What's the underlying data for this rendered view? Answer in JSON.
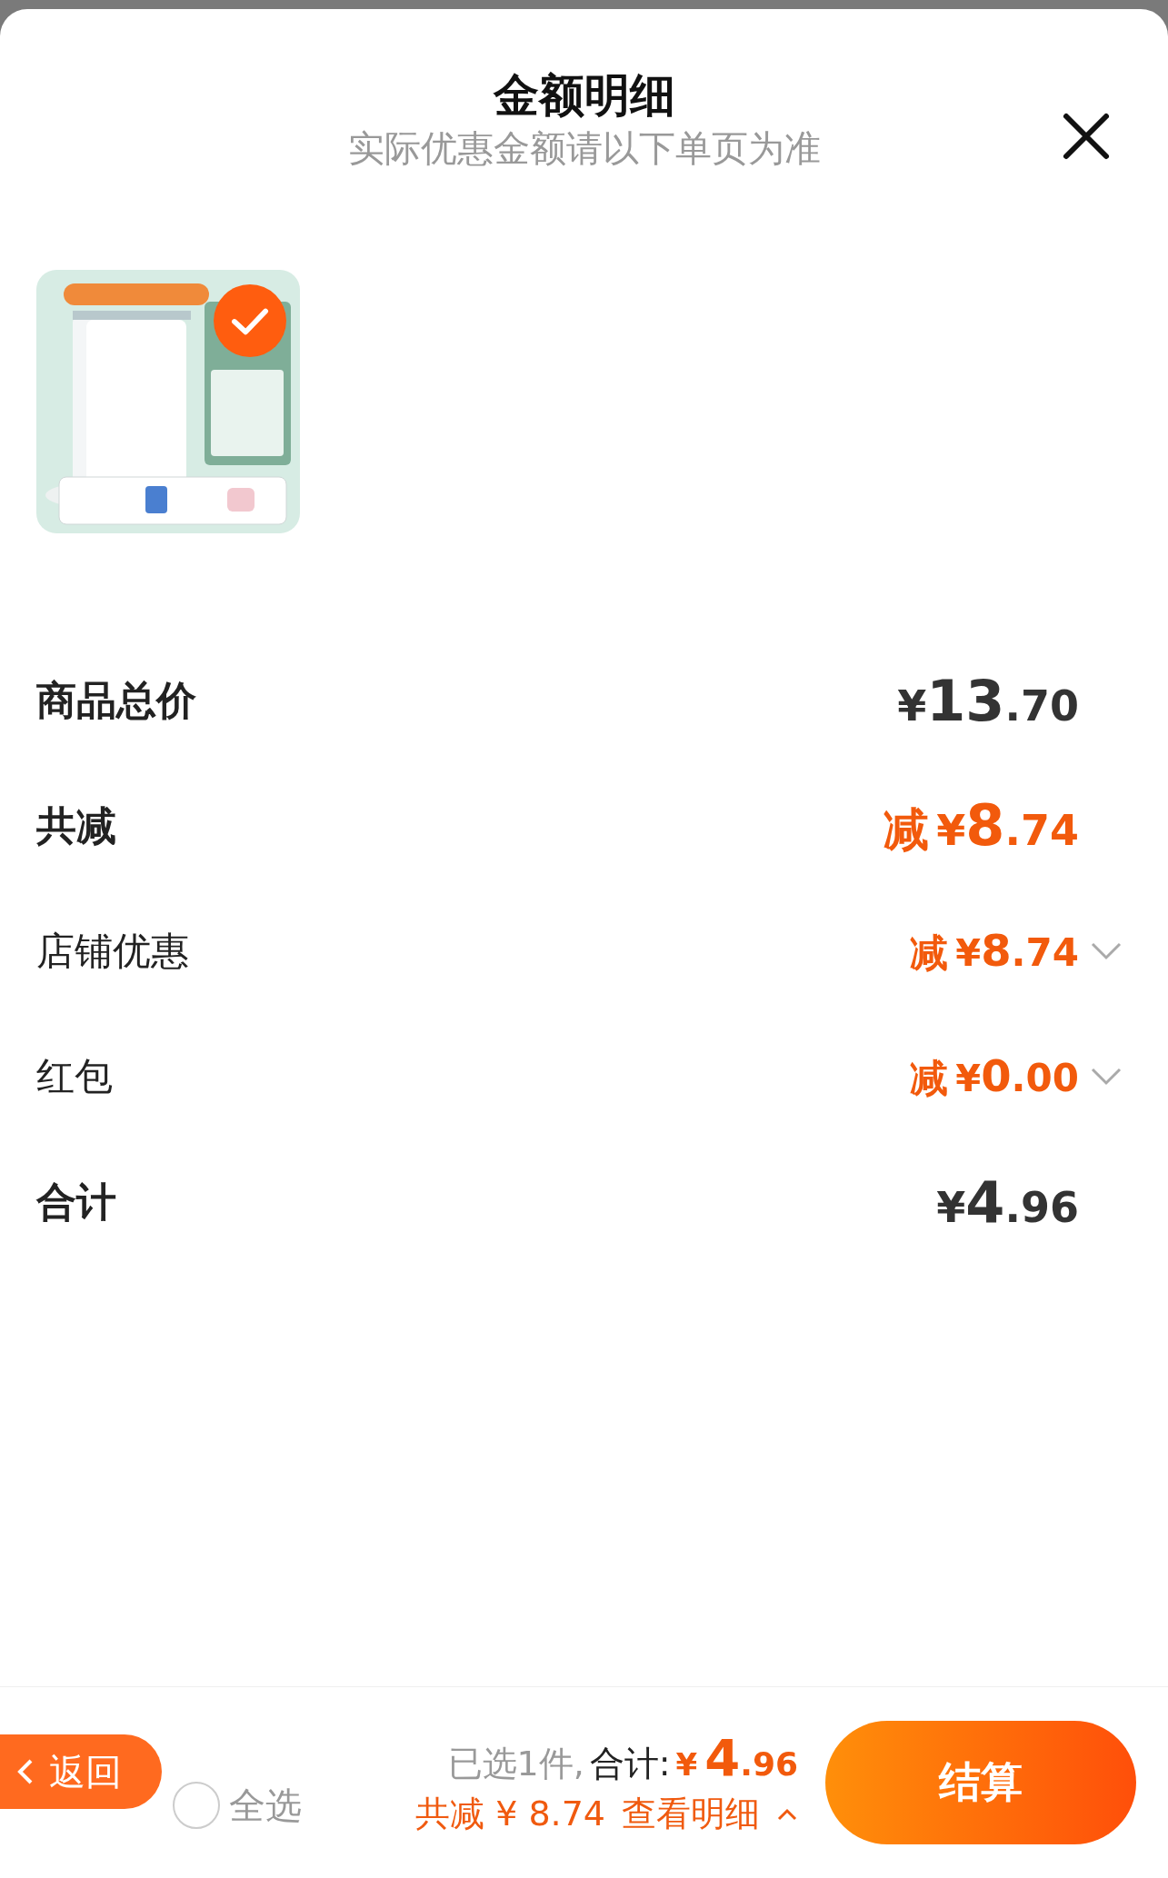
{
  "sheet": {
    "title": "金额明细",
    "subtitle": "实际优惠金额请以下单页为准"
  },
  "product": {
    "kind": "picture",
    "selected": true
  },
  "rows": [
    {
      "kind": "total",
      "label": "商品总价",
      "currency": "¥",
      "integer": "13",
      "fraction": ".70"
    },
    {
      "kind": "discount",
      "label": "共减",
      "prefix": "减",
      "currency": "¥",
      "integer": "8",
      "fraction": ".74"
    },
    {
      "kind": "detail",
      "label": "店铺优惠",
      "prefix": "减",
      "currency": "¥",
      "integer": "8",
      "fraction": ".74",
      "expanded": false
    },
    {
      "kind": "detail",
      "label": "红包",
      "prefix": "减",
      "currency": "¥",
      "integer": "0",
      "fraction": ".00",
      "expanded": false
    },
    {
      "kind": "total",
      "label": "合计",
      "currency": "¥",
      "integer": "4",
      "fraction": ".96"
    }
  ],
  "footer": {
    "back_button": "返回",
    "select_all": {
      "label": "全选",
      "checked": false
    },
    "selected_count": "已选1件,",
    "total_label": "合计:",
    "total_currency": "¥",
    "total_integer": "4",
    "total_fraction": ".96",
    "discount_summary": "共减 ¥ 8.74",
    "details_link": "查看明细",
    "details_expanded": false,
    "checkout_button": "结算"
  }
}
